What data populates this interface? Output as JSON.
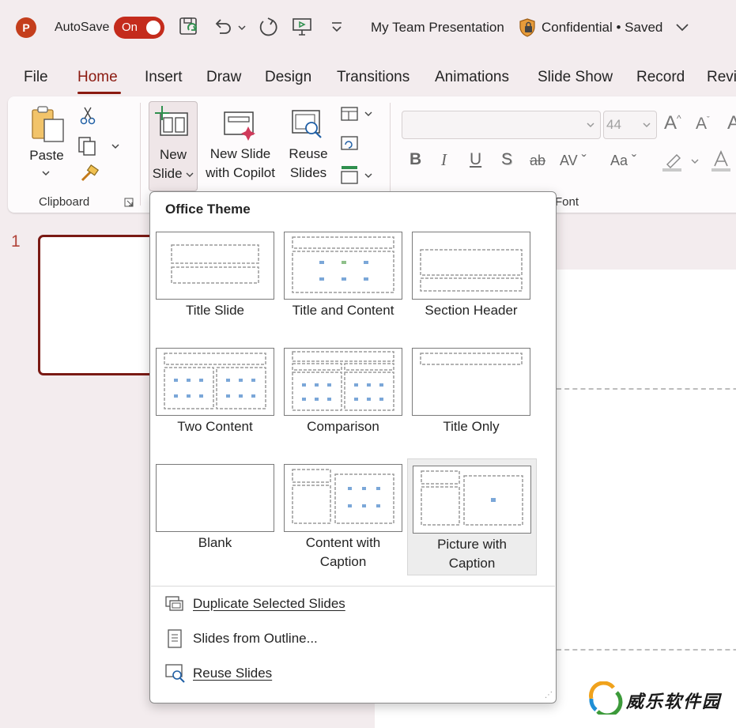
{
  "titlebar": {
    "autosave_label": "AutoSave",
    "autosave_state": "On",
    "doc_title": "My Team Presentation",
    "sensitivity": "Confidential • Saved"
  },
  "tabs": [
    "File",
    "Home",
    "Insert",
    "Draw",
    "Design",
    "Transitions",
    "Animations",
    "Slide Show",
    "Record",
    "Revi"
  ],
  "ribbon": {
    "paste": "Paste",
    "clipboard_group": "Clipboard",
    "new_slide": [
      "New",
      "Slide"
    ],
    "new_slide_copilot": [
      "New Slide",
      "with Copilot"
    ],
    "reuse_slides": [
      "Reuse",
      "Slides"
    ],
    "font_group": "Font",
    "font_size_placeholder": "44"
  },
  "slides_pane": {
    "slide_number": "1"
  },
  "dropdown": {
    "header": "Office Theme",
    "layouts": [
      {
        "label": "Title Slide"
      },
      {
        "label": "Title and Content"
      },
      {
        "label": "Section Header"
      },
      {
        "label": "Two Content"
      },
      {
        "label": "Comparison"
      },
      {
        "label": "Title Only"
      },
      {
        "label": "Blank"
      },
      {
        "label": "Content with Caption"
      },
      {
        "label": "Picture with Caption"
      }
    ],
    "menu_items": [
      {
        "label": "Duplicate Selected Slides",
        "icon": "duplicate-slides-icon"
      },
      {
        "label": "Slides from Outline...",
        "icon": "outline-document-icon"
      },
      {
        "label": "Reuse Slides",
        "icon": "reuse-slides-icon"
      }
    ]
  },
  "watermark": {
    "text": "威乐软件园"
  },
  "colors": {
    "accent": "#8b1a10",
    "toggle": "#c42b1c",
    "logo": "#c43e1c"
  }
}
